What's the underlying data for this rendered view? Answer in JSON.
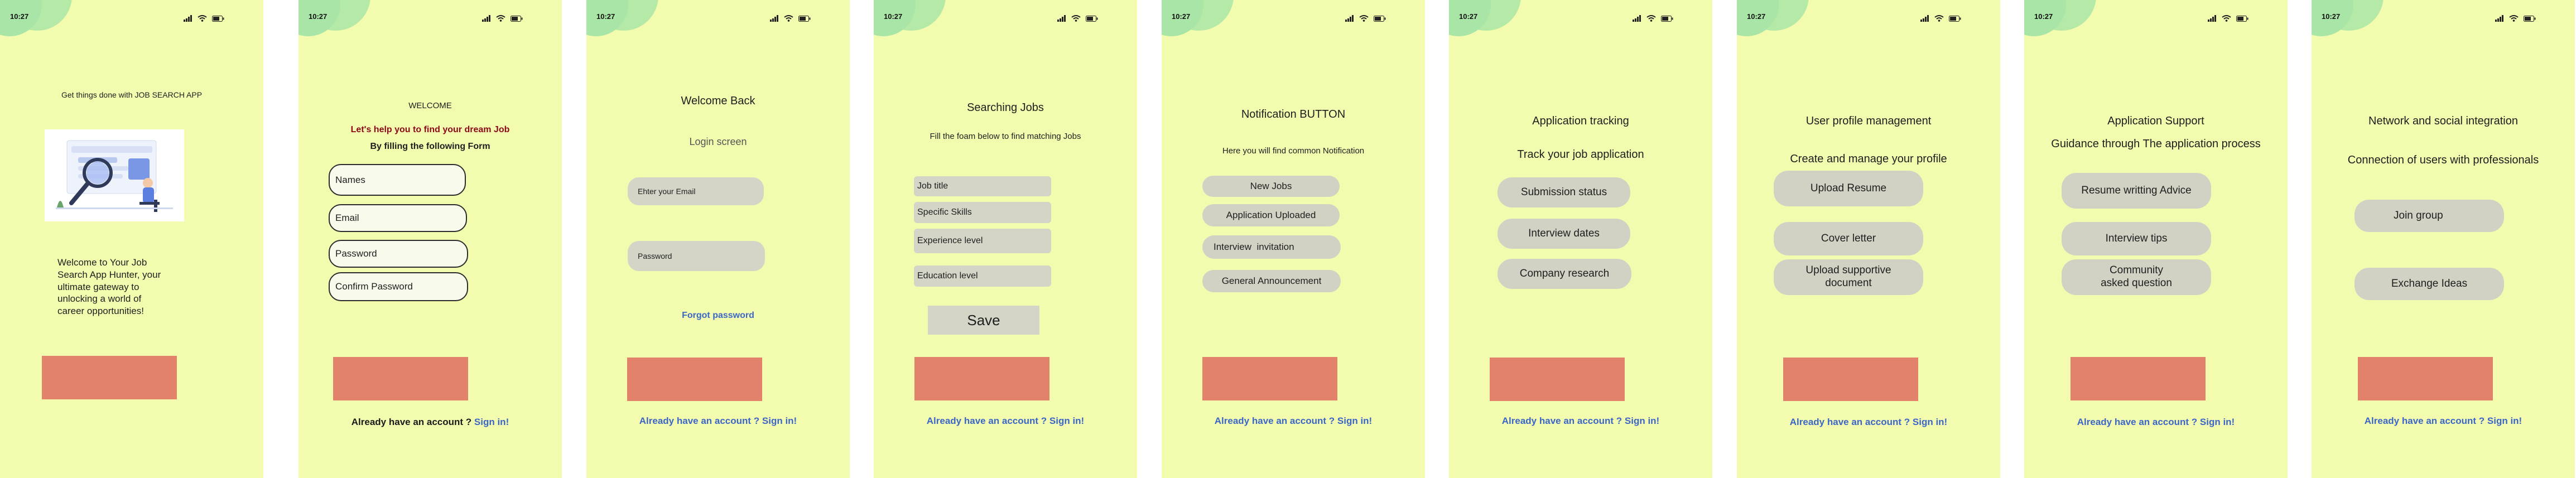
{
  "status_bar": {
    "time": "10:27",
    "icons": [
      "signal-icon",
      "wifi-icon",
      "battery-icon"
    ]
  },
  "colors": {
    "screen_bg": "#f2fbae",
    "blob": "#a9e5a6",
    "cta": "#e2826a",
    "pill": "#d2d2c4",
    "link": "#3b66c8",
    "tagline_red": "#8b0a1a"
  },
  "screens": {
    "s1": {
      "tagline": "Get things done with JOB SEARCH APP",
      "welcome_text": "Welcome to Your Job Search App Hunter, your ultimate gateway to unlocking a world of career opportunities!"
    },
    "s2": {
      "title": "WELCOME",
      "tagline": "Let's help you to find your dream Job",
      "subtitle": "By filling the following Form",
      "fields": [
        "Names",
        "Email",
        "Password",
        "Confirm Password"
      ],
      "signin_prefix": "Already have an account ?",
      "signin_link": "Sign in!"
    },
    "s3": {
      "title": "Welcome Back",
      "subtitle": "Login screen",
      "email": "Ehter your Email",
      "password": "Password",
      "forgot": "Forgot password",
      "signin": "Already have an account ? Sign in!"
    },
    "s4": {
      "title": "Searching Jobs",
      "subtitle": "Fill the foam below to find matching Jobs",
      "fields": [
        "Job title",
        "Specific Skills",
        "Experience level",
        "Education level"
      ],
      "save": "Save",
      "signin": "Already have an account ? Sign in!"
    },
    "s5": {
      "title": "Notification BUTTON",
      "subtitle": "Here you will find common Notification",
      "items": [
        "New Jobs",
        "Application Uploaded",
        "Interview  invitation",
        "General Announcement"
      ],
      "signin": "Already have an account ? Sign in!"
    },
    "s6": {
      "title": "Application tracking",
      "subtitle": "Track your job application",
      "items": [
        "Submission status",
        "Interview dates",
        "Company research"
      ],
      "signin": "Already have an account ? Sign in!"
    },
    "s7": {
      "title": "User profile management",
      "subtitle": "Create and manage your profile",
      "items": [
        "Upload Resume",
        "Cover letter",
        "Upload supportive document"
      ],
      "signin": "Already have an account ? Sign in!"
    },
    "s8": {
      "title": "Application Support",
      "subtitle": "Guidance through The application process",
      "items": [
        "Resume writting Advice",
        "Interview tips",
        "Community asked question"
      ],
      "signin": "Already have an account ? Sign in!"
    },
    "s9": {
      "title": "Network and social integration",
      "subtitle": "Connection of users with professionals",
      "items": [
        "Join group",
        "Exchange Ideas"
      ],
      "signin": "Already have an account ? Sign in!"
    }
  }
}
